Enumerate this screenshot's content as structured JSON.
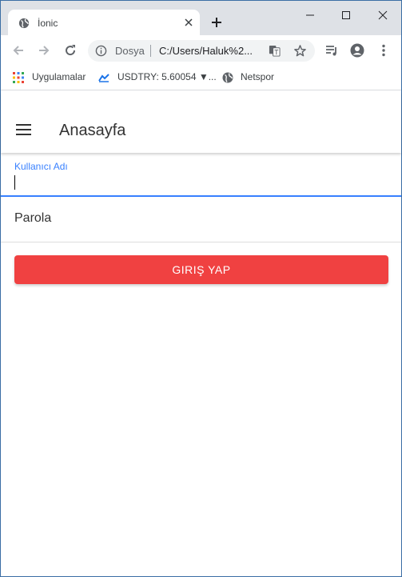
{
  "browser": {
    "tab_title": "İonic",
    "omnibox": {
      "scheme_label": "Dosya",
      "url": "C:/Users/Haluk%2..."
    },
    "bookmarks": [
      {
        "label": "Uygulamalar",
        "icon": "apps-grid-icon"
      },
      {
        "label": "USDTRY: 5.60054 ▼...",
        "icon": "chart-icon"
      },
      {
        "label": "Netspor",
        "icon": "globe-icon"
      }
    ]
  },
  "app": {
    "title": "Anasayfa",
    "form": {
      "username_label": "Kullanıcı Adı",
      "username_value": "",
      "password_label": "Parola",
      "login_button": "GIRIŞ YAP"
    }
  },
  "colors": {
    "primary": "#3880ff",
    "danger": "#f04141",
    "chrome_tabstrip": "#dee1e6"
  }
}
